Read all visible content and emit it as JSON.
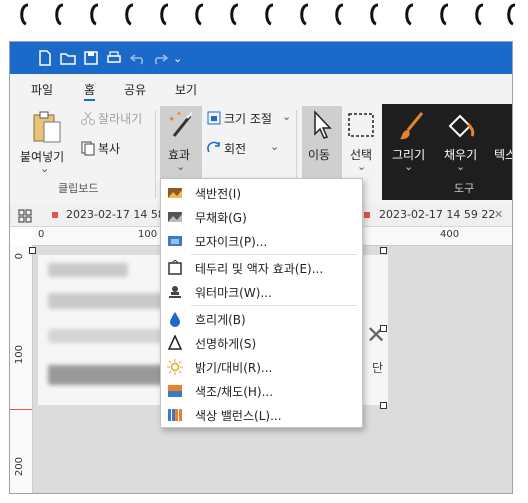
{
  "menu": {
    "items": [
      "파일",
      "홈",
      "공유",
      "보기"
    ]
  },
  "ribbon": {
    "paste": "붙여넣기",
    "cut": "잘라내기",
    "copy": "복사",
    "clipboard_group": "클립보드",
    "effects": "효과",
    "resize": "크기 조절",
    "rotate": "회전",
    "move": "이동",
    "select": "선택",
    "brush": "그리기",
    "fill": "채우기",
    "text": "텍스",
    "tools_group": "도구"
  },
  "tabs": {
    "tab1": "2023-02-17 14 58",
    "tab2": "2023-02-17 14 59 22"
  },
  "ruler": {
    "h_0": "0",
    "h_100": "100",
    "h_400": "400",
    "v_0": "0",
    "v_100": "100",
    "v_200": "200"
  },
  "canvas": {
    "close_glyph": "✕",
    "side_text": "단"
  },
  "dropdown": {
    "items": [
      {
        "label": "색반전(I)",
        "icon": "invert-icon"
      },
      {
        "label": "무채화(G)",
        "icon": "grayscale-icon"
      },
      {
        "label": "모자이크(P)...",
        "icon": "mosaic-icon"
      },
      {
        "label": "테두리 및 액자 효과(E)...",
        "icon": "frame-icon"
      },
      {
        "label": "워터마크(W)...",
        "icon": "watermark-icon"
      },
      {
        "label": "흐리게(B)",
        "icon": "blur-icon"
      },
      {
        "label": "선명하게(S)",
        "icon": "sharpen-icon"
      },
      {
        "label": "밝기/대비(R)...",
        "icon": "brightness-icon"
      },
      {
        "label": "색조/채도(H)...",
        "icon": "hue-icon"
      },
      {
        "label": "색상 밸런스(L)...",
        "icon": "color-balance-icon"
      }
    ]
  },
  "colors": {
    "titlebar": "#1b6ac9",
    "tools_bg": "#1e1e1e",
    "accent_orange": "#e8832a"
  }
}
